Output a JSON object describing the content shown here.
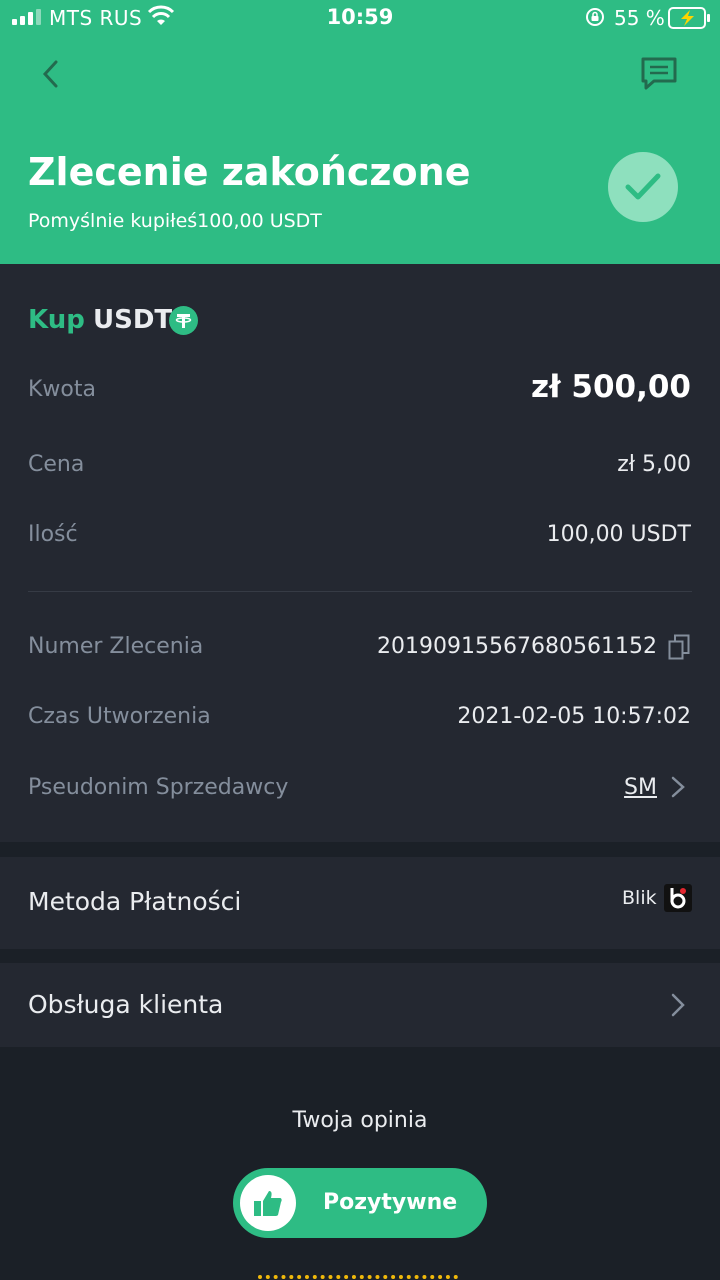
{
  "status_bar": {
    "carrier": "MTS RUS",
    "time": "10:59",
    "battery": "55 %"
  },
  "header": {
    "title": "Zlecenie zakończone",
    "subtitle": "Pomyślnie kupiłeś100,00 USDT",
    "accent_color": "#2ebc84",
    "icons": [
      "back-icon",
      "chat-icon",
      "check-icon"
    ]
  },
  "order": {
    "side": "Kup",
    "coin": "USDT",
    "coin_icon": "tether-icon",
    "rows": [
      {
        "label": "Kwota",
        "value": "zł 500,00"
      },
      {
        "label": "Cena",
        "value": "zł 5,00"
      },
      {
        "label": "Ilość",
        "value": "100,00 USDT"
      }
    ],
    "details": [
      {
        "label": "Numer Zlecenia",
        "value": "20190915567680561152"
      },
      {
        "label": "Czas Utworzenia",
        "value": "2021-02-05 10:57:02"
      },
      {
        "label": "Pseudonim Sprzedawcy",
        "value": "SM"
      }
    ]
  },
  "payment": {
    "label": "Metoda Płatności",
    "method": "Blik"
  },
  "support": {
    "label": "Obsługa klienta"
  },
  "feedback": {
    "title": "Twoja opinia",
    "positive_label": "Pozytywne"
  }
}
